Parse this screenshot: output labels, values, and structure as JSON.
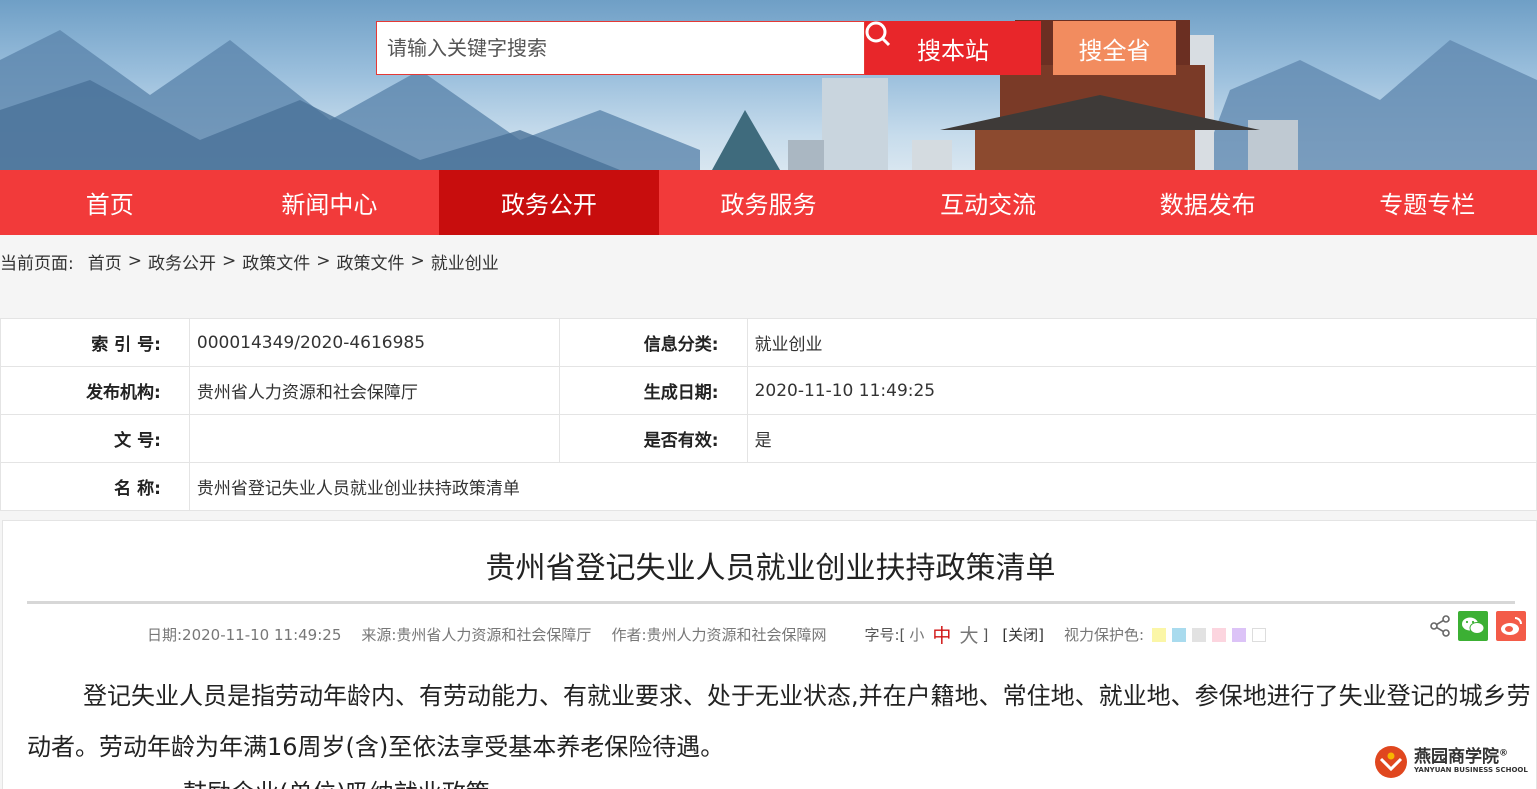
{
  "header": {
    "search_placeholder": "请输入关键字搜索",
    "search_site_label": "搜本站",
    "search_province_label": "搜全省"
  },
  "nav": {
    "items": [
      "首页",
      "新闻中心",
      "政务公开",
      "政务服务",
      "互动交流",
      "数据发布",
      "专题专栏"
    ],
    "active": "政务公开"
  },
  "breadcrumb": {
    "label": "当前页面:",
    "items": [
      "首页",
      "政务公开",
      "政策文件",
      "政策文件",
      "就业创业"
    ]
  },
  "info": {
    "index_key": "索 引 号:",
    "index_val": "000014349/2020-4616985",
    "category_key": "信息分类:",
    "category_val": "就业创业",
    "issuer_key": "发布机构:",
    "issuer_val": "贵州省人力资源和社会保障厅",
    "date_key": "生成日期:",
    "date_val": "2020-11-10 11:49:25",
    "docno_key": "文 号:",
    "docno_val": "",
    "valid_key": "是否有效:",
    "valid_val": "是",
    "name_key": "名 称:",
    "name_val": "贵州省登记失业人员就业创业扶持政策清单"
  },
  "article": {
    "title": "贵州省登记失业人员就业创业扶持政策清单",
    "date": "日期:2020-11-10 11:49:25",
    "source": "来源:贵州省人力资源和社会保障厅",
    "author": "作者:贵州人力资源和社会保障网",
    "font_label": "字号:[",
    "font_small": "小",
    "font_medium": "中",
    "font_large": "大",
    "font_end": "]",
    "close": "[关闭]",
    "eye_label": "视力保护色:",
    "eye_colors": [
      "#fbf6a7",
      "#a9dbee",
      "#e2e2e2",
      "#fcd5df",
      "#dcc3f7",
      "#ffffff"
    ],
    "para1": "登记失业人员是指劳动年龄内、有劳动能力、有就业要求、处于无业状态,并在户籍地、常住地、就业地、参保地进行了失业登记的城乡劳动者。劳动年龄为年满16周岁(含)至依法享受基本养老保险待遇。",
    "para2": "一、鼓励企业(单位)吸纳就业政策"
  },
  "watermark": {
    "cn": "燕园商学院",
    "en": "YANYUAN BUSINESS SCHOOL",
    "reg": "®"
  }
}
